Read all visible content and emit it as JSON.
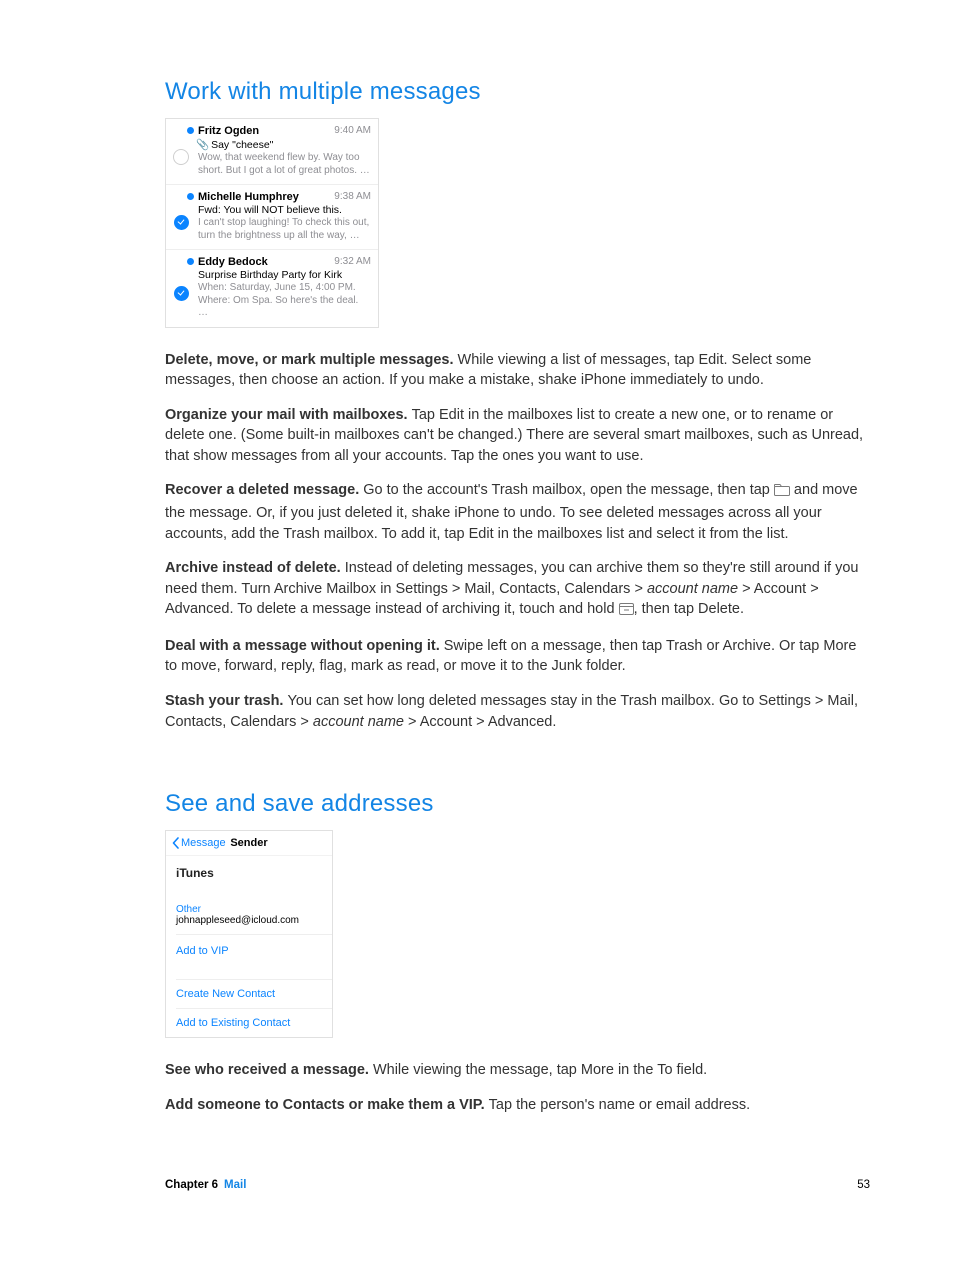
{
  "heading1": "Work with multiple messages",
  "heading2": "See and save addresses",
  "mock_mail": {
    "rows": [
      {
        "name": "Fritz Ogden",
        "time": "9:40 AM",
        "subject": "Say \"cheese\"",
        "preview": "Wow, that weekend flew by. Way too short. But I got a lot of great photos. …"
      },
      {
        "name": "Michelle Humphrey",
        "time": "9:38 AM",
        "subject": "Fwd: You will NOT believe this.",
        "preview": "I can't stop laughing! To check this out, turn the brightness up all the way, …"
      },
      {
        "name": "Eddy Bedock",
        "time": "9:32 AM",
        "subject": "Surprise Birthday Party for Kirk",
        "preview": "When: Saturday, June 15, 4:00 PM. Where: Om Spa. So here's the deal. …"
      }
    ]
  },
  "paras": {
    "p1b": "Delete, move, or mark multiple messages. ",
    "p1": "While viewing a list of messages, tap Edit. Select some messages, then choose an action. If you make a mistake, shake iPhone immediately to undo.",
    "p2b": "Organize your mail with mailboxes. ",
    "p2": "Tap Edit in the mailboxes list to create a new one, or to rename or delete one. (Some built-in mailboxes can't be changed.) There are several smart mailboxes, such as Unread, that show messages from all your accounts. Tap the ones you want to use.",
    "p3b": "Recover a deleted message. ",
    "p3a": "Go to the account's Trash mailbox, open the message, then tap ",
    "p3c": " and move the message. Or, if you just deleted it, shake iPhone to undo. To see deleted messages across all your accounts, add the Trash mailbox. To add it, tap Edit in the mailboxes list and select it from the list.",
    "p4b": "Archive instead of delete. ",
    "p4a": "Instead of deleting messages, you can archive them so they're still around if you need them. Turn Archive Mailbox in Settings > Mail, Contacts, Calendars > ",
    "p4i": "account name",
    "p4c": " > Account > Advanced. To delete a message instead of archiving it, touch and hold ",
    "p4d": ", then tap Delete.",
    "p5b": "Deal with a message without opening it. ",
    "p5": "Swipe left on a message, then tap Trash or Archive. Or tap More to move, forward, reply, flag, mark as read, or move it to the Junk folder.",
    "p6b": "Stash your trash. ",
    "p6a": "You can set how long deleted messages stay in the Trash mailbox. Go to Settings > Mail, Contacts, Calendars > ",
    "p6i": "account name",
    "p6c": " > Account > Advanced."
  },
  "mock_sender": {
    "back": "Message",
    "title": "Sender",
    "from": "iTunes",
    "other_label": "Other",
    "email": "johnappleseed@icloud.com",
    "add_vip": "Add to VIP",
    "create": "Create New Contact",
    "add_existing": "Add to Existing Contact"
  },
  "paras2": {
    "q1b": "See who received a message. ",
    "q1": "While viewing the message, tap More in the To field.",
    "q2b": "Add someone to Contacts or make them a VIP. ",
    "q2": "Tap the person's name or email address."
  },
  "footer": {
    "chapter_label": "Chapter  6",
    "section": "Mail",
    "page": "53"
  }
}
